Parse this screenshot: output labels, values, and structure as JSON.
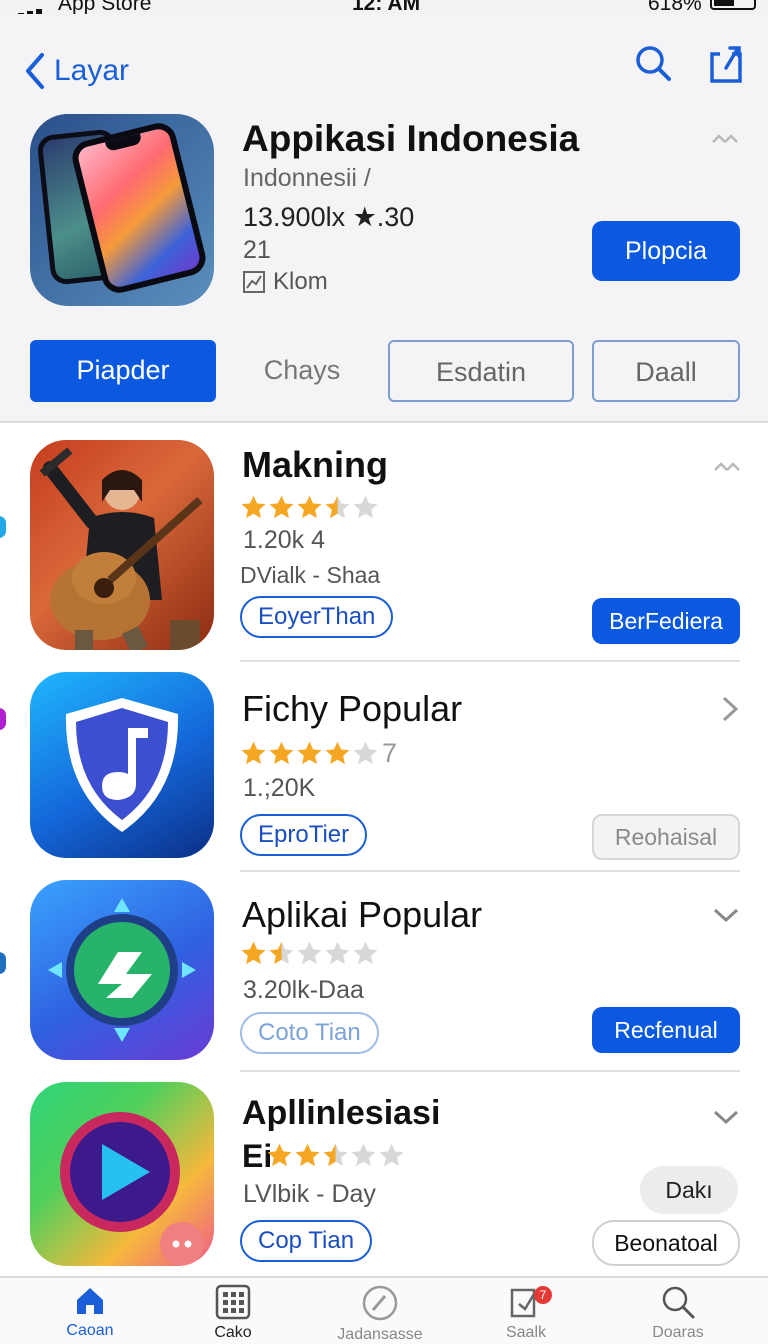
{
  "status_bar": {
    "carrier": "App Store",
    "time": "12: AM",
    "battery": "618%"
  },
  "header": {
    "back_label": "Layar"
  },
  "featured": {
    "title": "Appikasi Indonesia",
    "subtitle": "Indonnesii /",
    "rating": "13.900lx ★.30",
    "count": "21",
    "meta": "Klom",
    "action_label": "Plopcia"
  },
  "tabs": [
    "Piapder",
    "Chays",
    "Esdatin",
    "Daall"
  ],
  "apps": [
    {
      "title": "Makning",
      "rating": 3.5,
      "rating_suffix": "",
      "line1": "1.20k 4",
      "line2": "DVialk - Shaa",
      "tag": "EoyerThan",
      "action": "BerFediera",
      "action_style": "blue"
    },
    {
      "title": "Fichy Popular",
      "rating": 4,
      "rating_suffix": "7",
      "line1": "1.;20K",
      "line2": "",
      "tag": "EproTier",
      "action": "Reohaisal",
      "action_style": "gray"
    },
    {
      "title": "Aplikai Popular",
      "rating": 1.5,
      "rating_suffix": "",
      "line1": "3.20lk-Daa",
      "line2": "",
      "tag": "Coto Tian",
      "action": "Recfenual",
      "action_style": "blue"
    },
    {
      "title": "Apllinlesiasi",
      "title_prefix": "Ei",
      "rating": 2.5,
      "rating_suffix": "",
      "line1": "LVlbik - Day",
      "line2": "",
      "tag": "Cop Tian",
      "action": "Beonatoal",
      "action_secondary": "Dakı",
      "action_style": "outline"
    }
  ],
  "tabbar": {
    "items": [
      {
        "label": "Caoan",
        "icon": "home-icon",
        "active": true
      },
      {
        "label": "Cako",
        "icon": "grid-icon",
        "active": false
      },
      {
        "label": "Jadansasse",
        "icon": "compass-icon",
        "active": false
      },
      {
        "label": "Saalk",
        "icon": "updates-icon",
        "active": false,
        "badge": "7"
      },
      {
        "label": "Doaras",
        "icon": "search-icon",
        "active": false
      }
    ]
  },
  "colors": {
    "accent": "#0a59e0",
    "star": "#f5a623",
    "star_empty": "#d8d8d8"
  }
}
